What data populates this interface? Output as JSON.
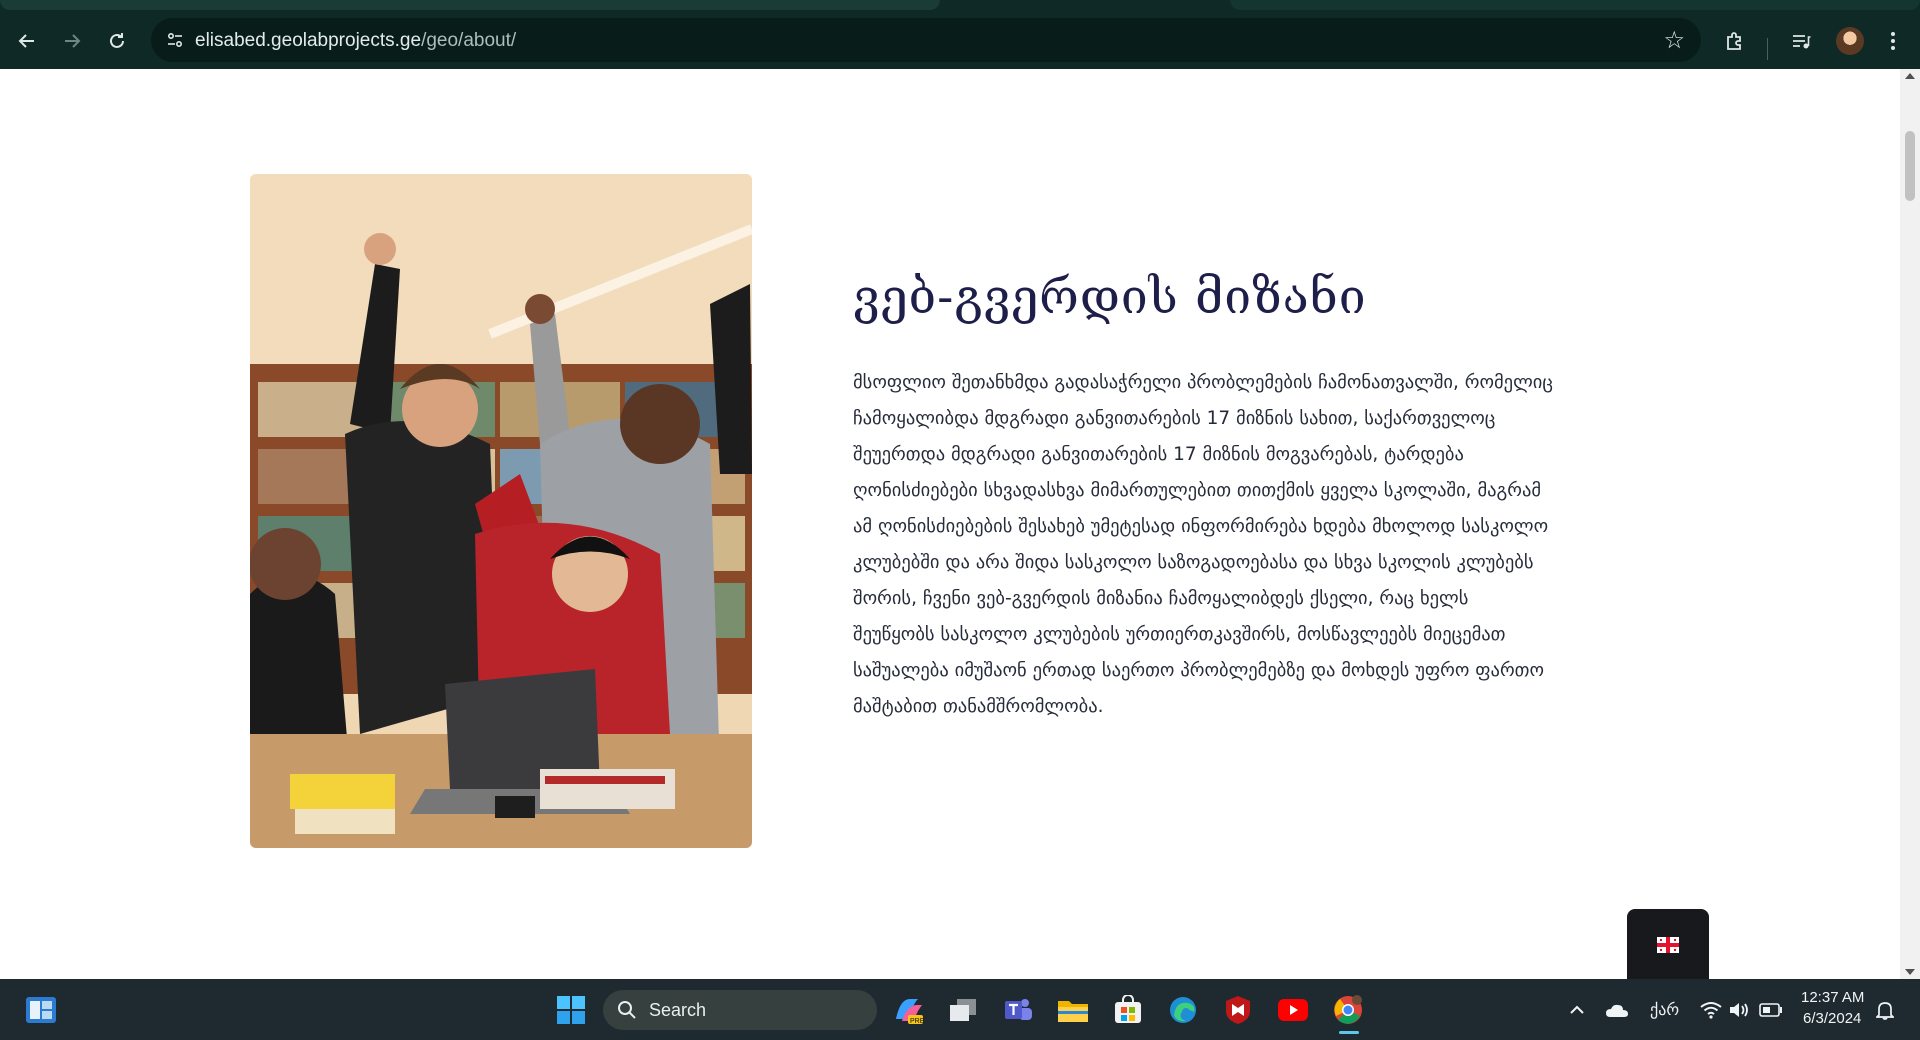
{
  "browser": {
    "url_host": "elisabed.geolabprojects.ge",
    "url_path": "/geo/about/",
    "icons": [
      "back-arrow-icon",
      "forward-arrow-icon",
      "reload-icon",
      "site-info-icon",
      "bookmark-star-icon",
      "extensions-icon",
      "media-control-icon",
      "profile-avatar",
      "more-menu-icon"
    ]
  },
  "page": {
    "title": "ვებ-გვერდის მიზანი",
    "paragraph": "მსოფლიო შეთანხმდა გადასაჭრელი პრობლემების ჩამონათვალში, რომელიც ჩამოყალიბდა მდგრადი განვითარების 17 მიზნის სახით, საქართველოც შეუერთდა მდგრადი განვითარების 17 მიზნის მოგვარებას, ტარდება ღონისძიებები სხვადასხვა მიმართულებით თითქმის ყველა სკოლაში, მაგრამ ამ ღონისძიებების შესახებ უმეტესად ინფორმირება ხდება მხოლოდ სასკოლო კლუბებში და არა შიდა სასკოლო საზოგადოებასა და სხვა სკოლის კლუბებს შორის, ჩვენი ვებ-გვერდის მიზანია ჩამოყალიბდეს ქსელი, რაც ხელს შეუწყობს სასკოლო კლუბების ურთიერთკავშირს, მოსწავლეებს მიეცემათ საშუალება იმუშაონ ერთად საერთო პრობლემებზე და მოხდეს უფრო ფართო მაშტაბით თანამშრომლობა.",
    "title_color": "#1e1e4a",
    "text_color": "#262b3a",
    "language_flag": "georgia-flag-icon"
  },
  "taskbar": {
    "search_label": "Search",
    "keyboard_layout": "ქარ",
    "time": "12:37 AM",
    "date": "6/3/2024",
    "apps": [
      "widgets-icon",
      "start-icon",
      "copilot-icon",
      "task-view-icon",
      "teams-icon",
      "file-explorer-icon",
      "store-icon",
      "edge-icon",
      "mcafee-icon",
      "youtube-icon",
      "chrome-icon"
    ]
  },
  "colors": {
    "chrome_bg": "#0f2a26",
    "taskbar_bg": "#1f2a30",
    "accent": "#5cc8e8"
  }
}
